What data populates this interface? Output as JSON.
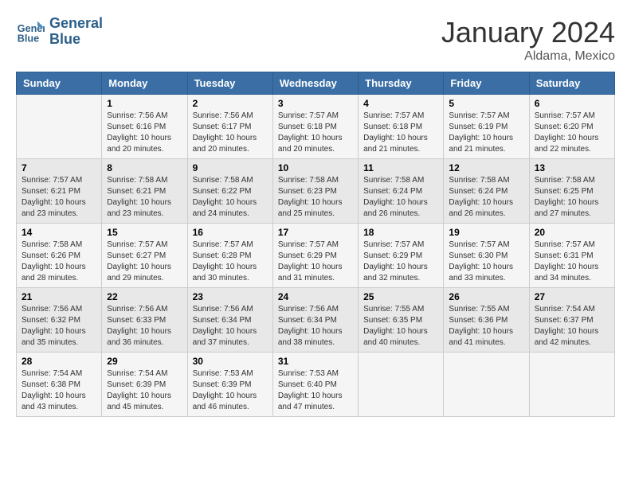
{
  "header": {
    "logo_line1": "General",
    "logo_line2": "Blue",
    "month_year": "January 2024",
    "location": "Aldama, Mexico"
  },
  "days_of_week": [
    "Sunday",
    "Monday",
    "Tuesday",
    "Wednesday",
    "Thursday",
    "Friday",
    "Saturday"
  ],
  "weeks": [
    [
      {
        "day": "",
        "info": ""
      },
      {
        "day": "1",
        "info": "Sunrise: 7:56 AM\nSunset: 6:16 PM\nDaylight: 10 hours\nand 20 minutes."
      },
      {
        "day": "2",
        "info": "Sunrise: 7:56 AM\nSunset: 6:17 PM\nDaylight: 10 hours\nand 20 minutes."
      },
      {
        "day": "3",
        "info": "Sunrise: 7:57 AM\nSunset: 6:18 PM\nDaylight: 10 hours\nand 20 minutes."
      },
      {
        "day": "4",
        "info": "Sunrise: 7:57 AM\nSunset: 6:18 PM\nDaylight: 10 hours\nand 21 minutes."
      },
      {
        "day": "5",
        "info": "Sunrise: 7:57 AM\nSunset: 6:19 PM\nDaylight: 10 hours\nand 21 minutes."
      },
      {
        "day": "6",
        "info": "Sunrise: 7:57 AM\nSunset: 6:20 PM\nDaylight: 10 hours\nand 22 minutes."
      }
    ],
    [
      {
        "day": "7",
        "info": "Sunrise: 7:57 AM\nSunset: 6:21 PM\nDaylight: 10 hours\nand 23 minutes."
      },
      {
        "day": "8",
        "info": "Sunrise: 7:58 AM\nSunset: 6:21 PM\nDaylight: 10 hours\nand 23 minutes."
      },
      {
        "day": "9",
        "info": "Sunrise: 7:58 AM\nSunset: 6:22 PM\nDaylight: 10 hours\nand 24 minutes."
      },
      {
        "day": "10",
        "info": "Sunrise: 7:58 AM\nSunset: 6:23 PM\nDaylight: 10 hours\nand 25 minutes."
      },
      {
        "day": "11",
        "info": "Sunrise: 7:58 AM\nSunset: 6:24 PM\nDaylight: 10 hours\nand 26 minutes."
      },
      {
        "day": "12",
        "info": "Sunrise: 7:58 AM\nSunset: 6:24 PM\nDaylight: 10 hours\nand 26 minutes."
      },
      {
        "day": "13",
        "info": "Sunrise: 7:58 AM\nSunset: 6:25 PM\nDaylight: 10 hours\nand 27 minutes."
      }
    ],
    [
      {
        "day": "14",
        "info": "Sunrise: 7:58 AM\nSunset: 6:26 PM\nDaylight: 10 hours\nand 28 minutes."
      },
      {
        "day": "15",
        "info": "Sunrise: 7:57 AM\nSunset: 6:27 PM\nDaylight: 10 hours\nand 29 minutes."
      },
      {
        "day": "16",
        "info": "Sunrise: 7:57 AM\nSunset: 6:28 PM\nDaylight: 10 hours\nand 30 minutes."
      },
      {
        "day": "17",
        "info": "Sunrise: 7:57 AM\nSunset: 6:29 PM\nDaylight: 10 hours\nand 31 minutes."
      },
      {
        "day": "18",
        "info": "Sunrise: 7:57 AM\nSunset: 6:29 PM\nDaylight: 10 hours\nand 32 minutes."
      },
      {
        "day": "19",
        "info": "Sunrise: 7:57 AM\nSunset: 6:30 PM\nDaylight: 10 hours\nand 33 minutes."
      },
      {
        "day": "20",
        "info": "Sunrise: 7:57 AM\nSunset: 6:31 PM\nDaylight: 10 hours\nand 34 minutes."
      }
    ],
    [
      {
        "day": "21",
        "info": "Sunrise: 7:56 AM\nSunset: 6:32 PM\nDaylight: 10 hours\nand 35 minutes."
      },
      {
        "day": "22",
        "info": "Sunrise: 7:56 AM\nSunset: 6:33 PM\nDaylight: 10 hours\nand 36 minutes."
      },
      {
        "day": "23",
        "info": "Sunrise: 7:56 AM\nSunset: 6:34 PM\nDaylight: 10 hours\nand 37 minutes."
      },
      {
        "day": "24",
        "info": "Sunrise: 7:56 AM\nSunset: 6:34 PM\nDaylight: 10 hours\nand 38 minutes."
      },
      {
        "day": "25",
        "info": "Sunrise: 7:55 AM\nSunset: 6:35 PM\nDaylight: 10 hours\nand 40 minutes."
      },
      {
        "day": "26",
        "info": "Sunrise: 7:55 AM\nSunset: 6:36 PM\nDaylight: 10 hours\nand 41 minutes."
      },
      {
        "day": "27",
        "info": "Sunrise: 7:54 AM\nSunset: 6:37 PM\nDaylight: 10 hours\nand 42 minutes."
      }
    ],
    [
      {
        "day": "28",
        "info": "Sunrise: 7:54 AM\nSunset: 6:38 PM\nDaylight: 10 hours\nand 43 minutes."
      },
      {
        "day": "29",
        "info": "Sunrise: 7:54 AM\nSunset: 6:39 PM\nDaylight: 10 hours\nand 45 minutes."
      },
      {
        "day": "30",
        "info": "Sunrise: 7:53 AM\nSunset: 6:39 PM\nDaylight: 10 hours\nand 46 minutes."
      },
      {
        "day": "31",
        "info": "Sunrise: 7:53 AM\nSunset: 6:40 PM\nDaylight: 10 hours\nand 47 minutes."
      },
      {
        "day": "",
        "info": ""
      },
      {
        "day": "",
        "info": ""
      },
      {
        "day": "",
        "info": ""
      }
    ]
  ]
}
